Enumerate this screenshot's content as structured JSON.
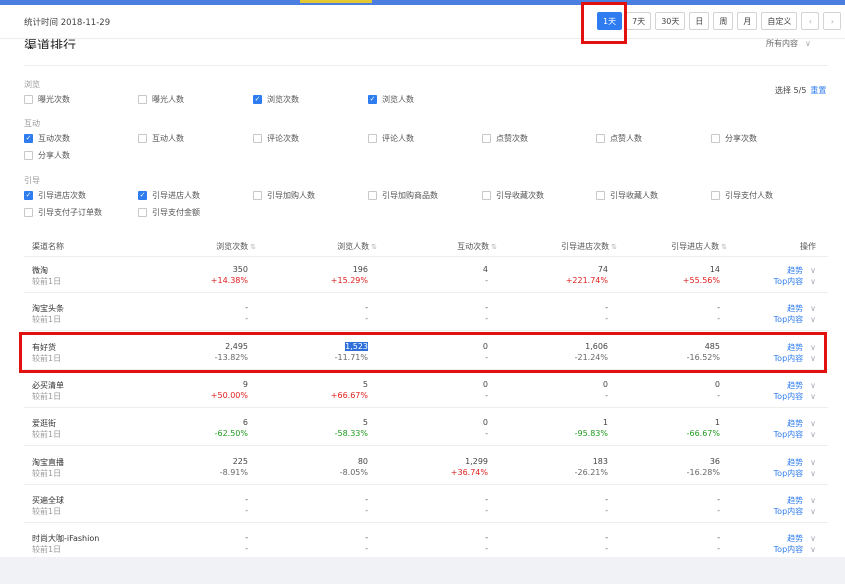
{
  "header": {
    "stat_time": "统计时间 2018-11-29",
    "ranges": [
      "1天",
      "7天",
      "30天",
      "日",
      "周",
      "月",
      "自定义"
    ],
    "active_range": "1天",
    "prev_icon": "chevron-left-icon",
    "next_icon": "chevron-right-icon"
  },
  "section": {
    "title": "渠道排行",
    "content_filter": "所有内容"
  },
  "metric_groups": [
    {
      "title": "浏览",
      "items": [
        {
          "label": "曝光次数",
          "checked": false
        },
        {
          "label": "曝光人数",
          "checked": false
        },
        {
          "label": "浏览次数",
          "checked": true
        },
        {
          "label": "浏览人数",
          "checked": true
        }
      ]
    },
    {
      "title": "互动",
      "items": [
        {
          "label": "互动次数",
          "checked": true
        },
        {
          "label": "互动人数",
          "checked": false
        },
        {
          "label": "评论次数",
          "checked": false
        },
        {
          "label": "评论人数",
          "checked": false
        },
        {
          "label": "点赞次数",
          "checked": false
        },
        {
          "label": "点赞人数",
          "checked": false
        },
        {
          "label": "分享次数",
          "checked": false
        },
        {
          "label": "分享人数",
          "checked": false
        }
      ]
    },
    {
      "title": "引导",
      "items": [
        {
          "label": "引导进店次数",
          "checked": true
        },
        {
          "label": "引导进店人数",
          "checked": true
        },
        {
          "label": "引导加购人数",
          "checked": false
        },
        {
          "label": "引导加购商品数",
          "checked": false
        },
        {
          "label": "引导收藏次数",
          "checked": false
        },
        {
          "label": "引导收藏人数",
          "checked": false
        },
        {
          "label": "引导支付人数",
          "checked": false
        },
        {
          "label": "引导支付子订单数",
          "checked": false
        },
        {
          "label": "引导支付金额",
          "checked": false
        }
      ]
    }
  ],
  "selection": {
    "text": "选择 5/5",
    "reset": "重置"
  },
  "table": {
    "columns": [
      "渠道名称",
      "浏览次数",
      "浏览人数",
      "互动次数",
      "引导进店次数",
      "引导进店人数",
      "操作"
    ],
    "action_labels": {
      "trend": "趋势",
      "top": "Top内容"
    },
    "rows": [
      {
        "name": "微淘",
        "sub": "较前1日",
        "values": [
          "350",
          "196",
          "4",
          "74",
          "14"
        ],
        "changes": [
          "+14.38%",
          "+15.29%",
          "-",
          "+221.74%",
          "+55.56%"
        ]
      },
      {
        "name": "淘宝头条",
        "sub": "较前1日",
        "values": [
          "-",
          "-",
          "-",
          "-",
          "-"
        ],
        "changes": [
          "-",
          "-",
          "-",
          "-",
          "-"
        ]
      },
      {
        "name": "有好货",
        "sub": "较前1日",
        "values": [
          "2,495",
          "1,523",
          "0",
          "1,606",
          "485"
        ],
        "changes": [
          "-13.82%",
          "-11.71%",
          "-",
          "-21.24%",
          "-16.52%"
        ]
      },
      {
        "name": "必买清单",
        "sub": "较前1日",
        "values": [
          "9",
          "5",
          "0",
          "0",
          "0"
        ],
        "changes": [
          "+50.00%",
          "+66.67%",
          "-",
          "-",
          "-"
        ]
      },
      {
        "name": "爱逛街",
        "sub": "较前1日",
        "values": [
          "6",
          "5",
          "0",
          "1",
          "1"
        ],
        "changes": [
          "-62.50%",
          "-58.33%",
          "-",
          "-95.83%",
          "-66.67%"
        ]
      },
      {
        "name": "淘宝直播",
        "sub": "较前1日",
        "values": [
          "225",
          "80",
          "1,299",
          "183",
          "36"
        ],
        "changes": [
          "-8.91%",
          "-8.05%",
          "+36.74%",
          "-26.21%",
          "-16.28%"
        ]
      },
      {
        "name": "买遍全球",
        "sub": "较前1日",
        "values": [
          "-",
          "-",
          "-",
          "-",
          "-"
        ],
        "changes": [
          "-",
          "-",
          "-",
          "-",
          "-"
        ]
      },
      {
        "name": "时尚大咖-iFashion",
        "sub": "较前1日",
        "values": [
          "-",
          "-",
          "-",
          "-",
          "-"
        ],
        "changes": [
          "-",
          "-",
          "-",
          "-",
          "-"
        ]
      }
    ]
  },
  "colors": {
    "accent": "#2e7cf0",
    "up": "#e02020",
    "down": "#1f9a1f",
    "annotation": "#e31010"
  }
}
